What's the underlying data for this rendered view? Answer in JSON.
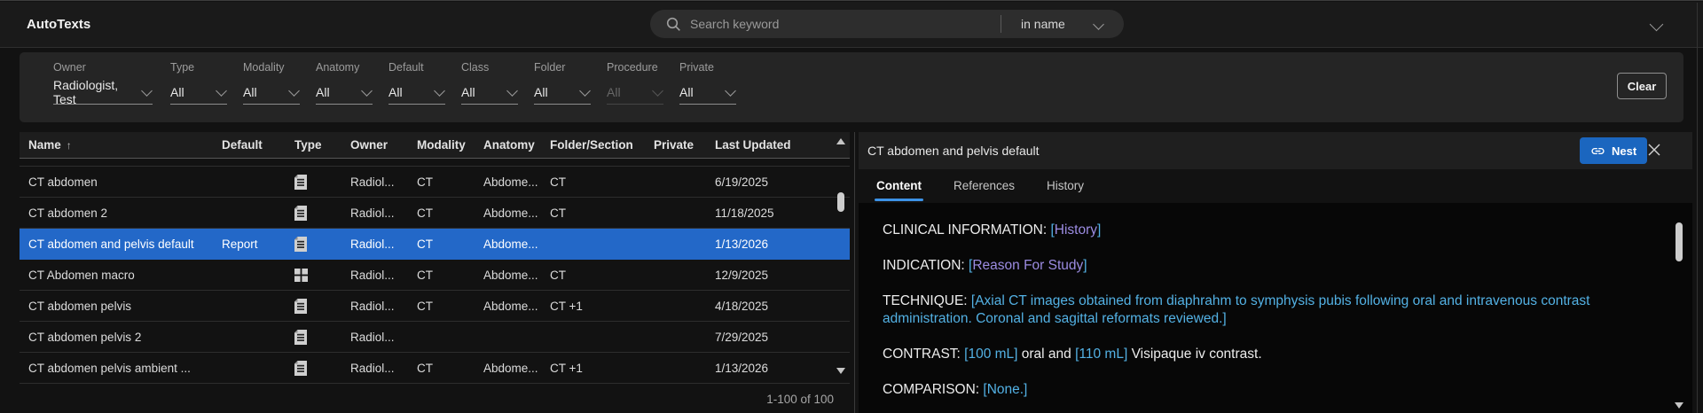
{
  "app": {
    "title": "AutoTexts"
  },
  "topbar": {
    "search_placeholder": "Search keyword",
    "search_scope": "in name"
  },
  "filters": {
    "clear_label": "Clear",
    "items": [
      {
        "label": "Owner",
        "value": "Radiologist, Test",
        "disabled": false
      },
      {
        "label": "Type",
        "value": "All",
        "disabled": false
      },
      {
        "label": "Modality",
        "value": "All",
        "disabled": false
      },
      {
        "label": "Anatomy",
        "value": "All",
        "disabled": false
      },
      {
        "label": "Default",
        "value": "All",
        "disabled": false
      },
      {
        "label": "Class",
        "value": "All",
        "disabled": false
      },
      {
        "label": "Folder",
        "value": "All",
        "disabled": false
      },
      {
        "label": "Procedure",
        "value": "All",
        "disabled": true
      },
      {
        "label": "Private",
        "value": "All",
        "disabled": false
      }
    ]
  },
  "table": {
    "columns": [
      "Name",
      "Default",
      "Type",
      "Owner",
      "Modality",
      "Anatomy",
      "Folder/Section",
      "Private",
      "Last Updated"
    ],
    "sort_column": "Name",
    "sort_indicator": "↑",
    "rows": [
      {
        "name": "CT abdomen",
        "default": "",
        "icon": "report",
        "owner": "Radiol...",
        "modality": "CT",
        "anatomy": "Abdome...",
        "folder": "CT",
        "private": "",
        "updated": "6/19/2025",
        "selected": false
      },
      {
        "name": "CT abdomen 2",
        "default": "",
        "icon": "report",
        "owner": "Radiol...",
        "modality": "CT",
        "anatomy": "Abdome...",
        "folder": "CT",
        "private": "",
        "updated": "11/18/2025",
        "selected": false
      },
      {
        "name": "CT abdomen and pelvis default",
        "default": "Report",
        "icon": "report",
        "owner": "Radiol...",
        "modality": "CT",
        "anatomy": "Abdome...",
        "folder": "",
        "private": "",
        "updated": "1/13/2026",
        "selected": true
      },
      {
        "name": "CT Abdomen macro",
        "default": "",
        "icon": "macro",
        "owner": "Radiol...",
        "modality": "CT",
        "anatomy": "Abdome...",
        "folder": "CT",
        "private": "",
        "updated": "12/9/2025",
        "selected": false
      },
      {
        "name": "CT abdomen pelvis",
        "default": "",
        "icon": "report",
        "owner": "Radiol...",
        "modality": "CT",
        "anatomy": "Abdome...",
        "folder": "CT +1",
        "private": "",
        "updated": "4/18/2025",
        "selected": false
      },
      {
        "name": "CT abdomen pelvis 2",
        "default": "",
        "icon": "report",
        "owner": "Radiol...",
        "modality": "",
        "anatomy": "",
        "folder": "",
        "private": "",
        "updated": "7/29/2025",
        "selected": false
      },
      {
        "name": "CT abdomen pelvis ambient ...",
        "default": "",
        "icon": "report",
        "owner": "Radiol...",
        "modality": "CT",
        "anatomy": "Abdome...",
        "folder": "CT +1",
        "private": "",
        "updated": "1/13/2026",
        "selected": false
      }
    ],
    "pagination": "1-100 of 100"
  },
  "panel": {
    "title": "CT abdomen and pelvis default",
    "nest_label": "Nest",
    "tabs": [
      "Content",
      "References",
      "History"
    ],
    "active_tab": "Content",
    "paragraphs": [
      {
        "segments": [
          {
            "text": "CLINICAL INFORMATION: ",
            "style": "plain"
          },
          {
            "text": "[",
            "style": "field"
          },
          {
            "text": "History",
            "style": "merge"
          },
          {
            "text": "]",
            "style": "field"
          }
        ]
      },
      {
        "segments": [
          {
            "text": "INDICATION: ",
            "style": "plain"
          },
          {
            "text": "[",
            "style": "field"
          },
          {
            "text": "Reason For Study",
            "style": "merge"
          },
          {
            "text": "]",
            "style": "field"
          }
        ]
      },
      {
        "segments": [
          {
            "text": "TECHNIQUE: ",
            "style": "plain"
          },
          {
            "text": "[Axial CT images obtained from diaphrahm to symphysis pubis following oral and intravenous contrast administration. Coronal and sagittal reformats reviewed.]",
            "style": "field"
          }
        ]
      },
      {
        "segments": [
          {
            "text": "CONTRAST: ",
            "style": "plain"
          },
          {
            "text": "[100 mL]",
            "style": "field"
          },
          {
            "text": " oral and ",
            "style": "plain"
          },
          {
            "text": "[110 mL]",
            "style": "field"
          },
          {
            "text": " Visipaque iv contrast.",
            "style": "plain"
          }
        ]
      },
      {
        "segments": [
          {
            "text": "COMPARISON: ",
            "style": "plain"
          },
          {
            "text": "[None.]",
            "style": "field"
          }
        ]
      }
    ]
  },
  "colors": {
    "selected_row": "#2368c8",
    "nest_button": "#1b66bf",
    "field_text": "#53b1e4",
    "merge_text": "#9c8ce2",
    "active_tab_underline": "#3c92e6"
  }
}
